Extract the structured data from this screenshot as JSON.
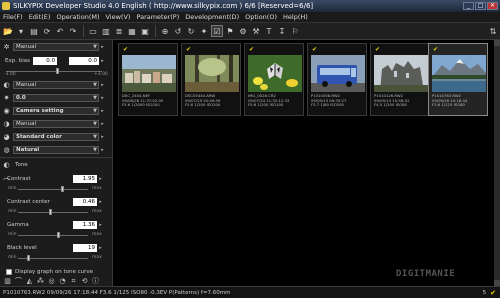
{
  "titlebar": {
    "title": "SILKYPIX Developer Studio 4.0 English ( http://www.silkypix.com )   6/6 [Reserved=6/6]"
  },
  "menu": [
    "File(F)",
    "Edit(E)",
    "Operation(M)",
    "View(V)",
    "Parameter(P)",
    "Development(D)",
    "Option(O)",
    "Help(H)"
  ],
  "panel": {
    "preset1": "Manual",
    "exposure_label": "Exp. bias",
    "exposure_value": "0.0",
    "exposure_value2": "0.0",
    "exposure_min": "-3.00",
    "exposure_max": "+3.00",
    "preset2": "Manual",
    "preset3": "0.0",
    "camera_setting": "Camera setting",
    "preset4": "Manual",
    "standard_color": "Standard color",
    "natural": "Natural",
    "tone_title": "Tone",
    "contrast_label": "Contrast",
    "contrast_value": "1.95",
    "center_label": "Contrast center",
    "center_value": "0.46",
    "gamma_label": "Gamma",
    "gamma_value": "1.36",
    "black_label": "Black level",
    "black_value": "19",
    "min": "min",
    "max": "max",
    "graph_label": "Display graph on tone curve"
  },
  "thumbnails": [
    {
      "file": "DSC_2404.NEF",
      "date": "09/08/28 11:37:02.00",
      "exp": "F5.6 1/2000 ISO200",
      "checked": true,
      "selected": false
    },
    {
      "file": "DSC05440.ARW",
      "date": "09/07/29 20:49:59",
      "exp": "F5.6 1/200 ISO200",
      "checked": true,
      "selected": false
    },
    {
      "file": "IMG_0028.CR2",
      "date": "09/07/24 11:32:12.33",
      "exp": "F5.6 1/200 ISO100",
      "checked": true,
      "selected": false
    },
    {
      "file": "P1010058.RW2",
      "date": "09/09/13 09:33:27",
      "exp": "F3.7 1/80 ISO200",
      "checked": true,
      "selected": false
    },
    {
      "file": "P1010126.RW2",
      "date": "09/09/13 15:58:41",
      "exp": "F4.5 1/200 ISO80",
      "checked": true,
      "selected": false
    },
    {
      "file": "P1010763.RW2",
      "date": "09/09/26 10:18:44",
      "exp": "F3.6 1/125 ISO80",
      "checked": true,
      "selected": true
    }
  ],
  "status": {
    "info": "P1010763.RW2 09/09/26 17:18:44 F3.6 1/125 ISO80 -0.3EV P(Patterns) f=7.60mm",
    "count": "5",
    "watermark": "DIGITMANIE"
  },
  "colors": {
    "check": "#f0d800",
    "accent": "#3a4a66"
  },
  "icons": [
    "folder-open-icon",
    "save-icon",
    "undo-icon",
    "redo-icon",
    "zoom-icon",
    "grid-icon",
    "develop-icon"
  ]
}
